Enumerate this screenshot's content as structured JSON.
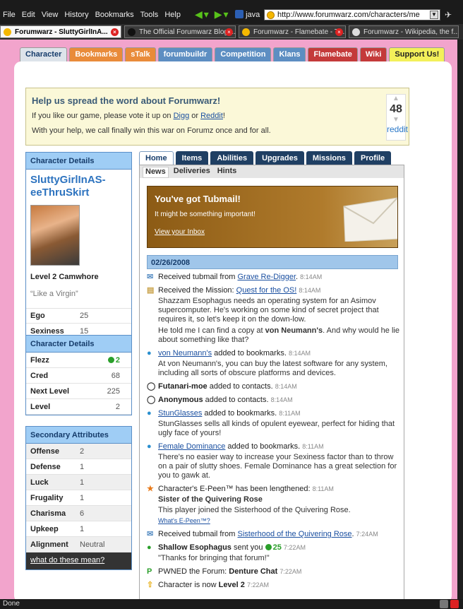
{
  "browser": {
    "menu": [
      "File",
      "Edit",
      "View",
      "History",
      "Bookmarks",
      "Tools",
      "Help"
    ],
    "search_label": "java",
    "url": "http://www.forumwarz.com/characters/me",
    "tabs": [
      {
        "label": "Forumwarz - SluttyGirlInA...",
        "active": true,
        "icon_color": "#f5b800"
      },
      {
        "label": "The Official Forumwarz Blog ...",
        "active": false,
        "icon_color": "#111111"
      },
      {
        "label": "Forumwarz - Flamebate - Th...",
        "active": false,
        "icon_color": "#f5b800"
      },
      {
        "label": "Forumwarz - Wikipedia, the f...",
        "active": false,
        "icon_color": "#dddddd"
      }
    ],
    "status": "Done"
  },
  "site_nav": [
    {
      "label": "Character",
      "bg": "#dde3ea",
      "fg": "#163c6b"
    },
    {
      "label": "Bookmarks",
      "bg": "#e98b3a",
      "fg": "#ffffff"
    },
    {
      "label": "sTalk",
      "bg": "#e98b3a",
      "fg": "#ffffff"
    },
    {
      "label": "forumbuildr",
      "bg": "#5d8ec2",
      "fg": "#ffffff"
    },
    {
      "label": "Competition",
      "bg": "#5d8ec2",
      "fg": "#ffffff"
    },
    {
      "label": "Klans",
      "bg": "#5d8ec2",
      "fg": "#ffffff"
    },
    {
      "label": "Flamebate",
      "bg": "#c43a3a",
      "fg": "#ffffff"
    },
    {
      "label": "Wiki",
      "bg": "#c43a3a",
      "fg": "#ffffff"
    },
    {
      "label": "Support Us!",
      "bg": "#f3f05a",
      "fg": "#222222"
    }
  ],
  "promo": {
    "title": "Help us spread the word about Forumwarz!",
    "line1_pre": "If you like our game, please vote it up on ",
    "digg": "Digg",
    "or": " or ",
    "reddit": "Reddit",
    "excl": "!",
    "line2": "With your help, we call finally win this war on Forumz once and for all.",
    "votes": "48",
    "reddit_logo": "reddit"
  },
  "character": {
    "header": "Character Details",
    "name": "SluttyGirlInAS-eeThruSkirt",
    "rank": "Level 2 Camwhore",
    "quote": "“Like a Virgin”",
    "ego_label": "Ego",
    "ego": "25",
    "sexiness_label": "Sexiness",
    "sexiness": "15"
  },
  "details": {
    "header": "Character Details",
    "rows": [
      {
        "k": "Flezz",
        "v": "2",
        "green": true
      },
      {
        "k": "Cred",
        "v": "68"
      },
      {
        "k": "Next Level",
        "v": "225"
      },
      {
        "k": "Level",
        "v": "2"
      }
    ]
  },
  "secondary": {
    "header": "Secondary Attributes",
    "rows": [
      {
        "k": "Offense",
        "v": "2"
      },
      {
        "k": "Defense",
        "v": "1"
      },
      {
        "k": "Luck",
        "v": "1"
      },
      {
        "k": "Frugality",
        "v": "1"
      },
      {
        "k": "Charisma",
        "v": "6"
      },
      {
        "k": "Upkeep",
        "v": "1"
      },
      {
        "k": "Alignment",
        "v": "Neutral"
      }
    ],
    "link": "what do these mean?"
  },
  "content_tabs": [
    "Home",
    "Items",
    "Abilities",
    "Upgrades",
    "Missions",
    "Profile"
  ],
  "sub_tabs": [
    "News",
    "Deliveries",
    "Hints"
  ],
  "tubmail": {
    "title": "You've got Tubmail!",
    "text": "It might be something important!",
    "link": "View your Inbox"
  },
  "date": "02/26/2008",
  "feed": [
    {
      "icon": "mail",
      "pre": "Received tubmail from ",
      "link": "Grave Re-Digger",
      "post": ".",
      "time": "8:14AM"
    },
    {
      "icon": "mission",
      "pre": "Received the Mission: ",
      "link": "Quest for the OS!",
      "post": "",
      "time": "8:14AM",
      "desc": "Shazzam Esophagus needs an operating system for an Asimov supercomputer. He's working on some kind of secret project that requires it, so let's keep it on the down-low.",
      "desc2_pre": "He told me I can find a copy at ",
      "desc2_bold": "von Neumann's",
      "desc2_post": ". And why would he lie about something like that?"
    },
    {
      "icon": "globe",
      "pre": "",
      "link": "von Neumann's",
      "post": " added to bookmarks.",
      "time": "8:14AM",
      "desc": "At von Neumann's, you can buy the latest software for any system, including all sorts of obscure platforms and devices."
    },
    {
      "icon": "bubble",
      "bold": "Futanari-moe",
      "post": " added to contacts.",
      "time": "8:14AM"
    },
    {
      "icon": "bubble",
      "bold": "Anonymous",
      "post": " added to contacts.",
      "time": "8:14AM"
    },
    {
      "icon": "globe",
      "pre": "",
      "link": "StunGlasses",
      "post": " added to bookmarks.",
      "time": "8:11AM",
      "desc": "StunGlasses sells all kinds of opulent eyewear, perfect for hiding that ugly face of yours!"
    },
    {
      "icon": "globe",
      "pre": "",
      "link": "Female Dominance",
      "post": " added to bookmarks.",
      "time": "8:11AM",
      "desc": "There's no easier way to increase your Sexiness factor than to throw on a pair of slutty shoes. Female Dominance has a great selection for you to gawk at."
    },
    {
      "icon": "star",
      "pre": "Character's E-Peen™ has been lengthened: ",
      "time": "8:11AM",
      "sub_bold": "Sister of the Quivering Rose",
      "desc": "This player joined the Sisterhood of the Quivering Rose.",
      "small_link": "What's E-Peen™?"
    },
    {
      "icon": "mail",
      "pre": "Received tubmail from ",
      "link": "Sisterhood of the Quivering Rose",
      "post": ".",
      "time": "7:24AM"
    },
    {
      "icon": "flezz",
      "bold": "Shallow Esophagus",
      "post": " sent you ",
      "amount": "25",
      "time": "7:22AM",
      "desc": "\"Thanks for bringing that forum!\""
    },
    {
      "icon": "pwn",
      "pre": "PWNED the Forum: ",
      "bold2": "Denture Chat",
      "time": "7:22AM"
    },
    {
      "icon": "up",
      "pre": "Character is now ",
      "bold2": "Level 2",
      "time": "7:22AM"
    }
  ]
}
